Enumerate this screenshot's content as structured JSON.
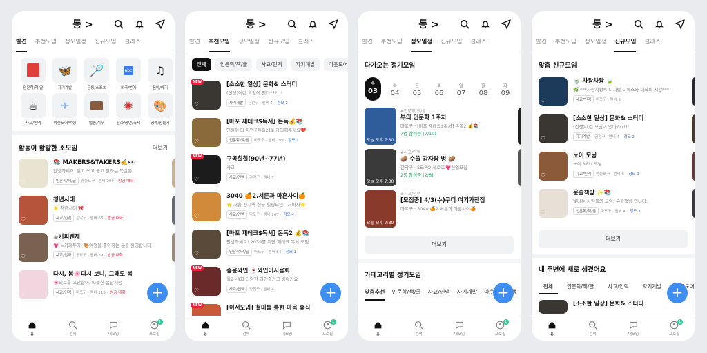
{
  "common": {
    "location": "동 >",
    "tabs": [
      "발견",
      "추천모임",
      "정모일정",
      "신규모임",
      "클래스"
    ],
    "nav": [
      "홈",
      "검색",
      "내모임",
      "프로필"
    ],
    "nav_badge": "1",
    "fab": "+",
    "new_badge": "NEW"
  },
  "discover": {
    "categories": [
      {
        "label": "인문학/책/글",
        "icon": "book-icon",
        "color": "#e0403c"
      },
      {
        "label": "자기계발",
        "icon": "butterfly-icon",
        "color": "#3f7be8"
      },
      {
        "label": "운동/스포츠",
        "icon": "racket-icon",
        "color": "#c98b2c"
      },
      {
        "label": "외국/언어",
        "icon": "abc-icon",
        "color": "#3f7be8"
      },
      {
        "label": "음악/악기",
        "icon": "music-note-icon",
        "color": "#222222"
      },
      {
        "label": "사교/인맥",
        "icon": "coffee-icon",
        "color": "#333333"
      },
      {
        "label": "아웃도어/여행",
        "icon": "airplane-icon",
        "color": "#8fb6e8"
      },
      {
        "label": "업종/직무",
        "icon": "briefcase-icon",
        "color": "#8a5a3c"
      },
      {
        "label": "문화/공연/축제",
        "icon": "firework-icon",
        "color": "#d13a3a"
      },
      {
        "label": "공예/만들기",
        "icon": "palette-icon",
        "color": "#d69a3a"
      }
    ],
    "section_title": "활동이 활발한 소모임",
    "more": "더보기",
    "items": [
      {
        "title": "📚 MAKERS&TAKERS✍️👀",
        "desc": "안녕하세요. 읽고 쓰고 듣고 말하는 북살롱",
        "tag": "인문학/책/글",
        "meta": "영등포구 · 멤버 290 ·",
        "status": "방금 대화",
        "thumb": "#e9e3d2"
      },
      {
        "title": "청년시대",
        "desc": "⭐ 청년시대 🎀",
        "tag": "사교/인맥",
        "meta": "관악구 · 멤버 68 ·",
        "status": "방금 대화",
        "thumb": "#b5543a"
      },
      {
        "title": "☕커피렌체",
        "desc": "💗 ☕카페투어, 🎨여행을 좋아하는 분들 환영합니다",
        "tag": "사교/인맥",
        "meta": "동작구 · 멤버 39 ·",
        "status": "방금 대화",
        "thumb": "#7a6252"
      },
      {
        "title": "다시, 봄🌸다시 보니, 그래도 봄",
        "desc": "🌸외로움 고단함이, 따뜻한 봄날처럼",
        "tag": "사교/인맥",
        "meta": "마포구 · 멤버 113 ·",
        "status": "방금 대화",
        "thumb": "#f2d6df"
      }
    ]
  },
  "recommend": {
    "chips": [
      "전체",
      "인문학/책/글",
      "사교/인맥",
      "자기계발",
      "아웃도어/여행"
    ],
    "items": [
      {
        "title": "[소소한 일상] 문화& 스터디",
        "desc": "(신생)이런 모임이 있다???!!!",
        "tag": "자기계발",
        "meta": "금천구 · 멤버 4 ·",
        "status": "정모 2",
        "thumb": "#3a3632",
        "new": true
      },
      {
        "title": "[마포 재테크$독서] 돈독💰📚",
        "desc": "인원이 다 차면 [돈독2]로 가입해주세요❤️",
        "tag": "인문학/책/글",
        "meta": "마포구 · 멤버 299 ·",
        "status": "정모 1",
        "thumb": "#8a6a3a",
        "new": false
      },
      {
        "title": "구공칠칠(90년~77년)",
        "desc": "사교",
        "tag": "사교/인맥",
        "meta": "관악구 · 멤버 7",
        "status": "",
        "thumb": "#1c1c1c",
        "new": true
      },
      {
        "title": "3040 🍊2.서른과 마흔사이🍊",
        "desc": "⭐ 서울 전지역 싱글 힐링모임 - 서마사⭐",
        "tag": "사교/인맥",
        "meta": "마포구 · 멤버 267 ·",
        "status": "정모 4",
        "thumb": "#d08a3a",
        "new": false
      },
      {
        "title": "[마포 재테크$독서] 돈독2 💰📚",
        "desc": "안녕하세요! 2039를 위한 재테크 독서 모임.",
        "tag": "인문학/책/글",
        "meta": "마포구 · 멤버 64 ·",
        "status": "정모 1",
        "thumb": "#5a4a3a",
        "new": false
      },
      {
        "title": "송윤와인 🍷와인이시음회",
        "desc": "월2~4회 다양한 와인즐기고 배워가요",
        "tag": "사교/인맥",
        "meta": "양천구 · 멤버 4",
        "status": "",
        "thumb": "#6a2a2a",
        "new": true
      },
      {
        "title": "[이서모임] 철미를 통한 마음 휴식",
        "desc": "",
        "tag": "",
        "meta": "",
        "status": "",
        "thumb": "#c85a3a",
        "new": true
      }
    ]
  },
  "schedule": {
    "section_title": "다가오는 정기모임",
    "dates": [
      {
        "day": "수",
        "num": "03"
      },
      {
        "day": "목",
        "num": "04"
      },
      {
        "day": "금",
        "num": "05"
      },
      {
        "day": "토",
        "num": "06"
      },
      {
        "day": "일",
        "num": "07"
      },
      {
        "day": "월",
        "num": "08"
      },
      {
        "day": "화",
        "num": "09"
      }
    ],
    "items": [
      {
        "cat": "#인문학/책/글",
        "title": "부의 인문학 1주차",
        "place": "마포구 · [마포 재테크$독서] 돈독2 💰📚",
        "attend": "7명 참석중 (7/10)",
        "time": "오늘 오후 7:30",
        "thumb": "#2f5c9a"
      },
      {
        "cat": "#사교/인맥",
        "title": "🥔 수쓸 감자탕 벙 🥔",
        "place": "관악구 · SE:RO 세로🐭💗신입모집",
        "attend": "2명 참석중 (2/8)",
        "time": "오늘 오후 7:30",
        "thumb": "#3a3a3a"
      },
      {
        "cat": "#사교/인맥",
        "title": "[모집중] 4/3(수)구디 여기가전집",
        "place": "마포구 · 3040 🍊2.서른과 마흔사이🍊",
        "attend": "",
        "time": "오늘 오후 7:30",
        "thumb": "#8a3a2a"
      }
    ],
    "more": "더보기",
    "cat_title": "카테고리별 정기모임",
    "cat_tabs": [
      "맞춤추천",
      "인문학/책/글",
      "사교/인맥",
      "자기계발",
      "아웃도어/여행"
    ]
  },
  "newgroups": {
    "section_title": "맞춤 신규모임",
    "items": [
      {
        "title": "🍵 차왕차왕 🍃",
        "desc": "🌿 ***차왕차왕*: 디지털 디톡스와 대화의 시간***",
        "tag": "사교/인맥",
        "meta": "마포구 · 멤버 5",
        "status": "",
        "thumb": "#1c3a5a"
      },
      {
        "title": "[소소한 일상] 문화& 스터디",
        "desc": "(신생)이런 모임이 있다???!!!",
        "tag": "자기계발",
        "meta": "금천구 · 멤버 4 ·",
        "status": "정모 2",
        "thumb": "#3a3632"
      },
      {
        "title": "노이 모닝",
        "desc": "노이 NEU 모닝",
        "tag": "사교/인맥",
        "meta": "영등포구 · 멤버 6 ·",
        "status": "정모 1",
        "thumb": "#8a5a3a"
      },
      {
        "title": "윤슬책방 ✨📚",
        "desc": "빛나는 사람들의 모임, 윤슬책방 입니다.",
        "tag": "인문학/책/글",
        "meta": "마포구 · 멤버 4 ·",
        "status": "정모 3",
        "thumb": "#e6e0d6"
      }
    ],
    "more": "더보기",
    "nearby_title": "내 주변에 새로 생겼어요",
    "chips": [
      "전체",
      "인문학/책/글",
      "사교/인맥",
      "자기계발",
      "아웃도어/여행"
    ],
    "peek_title": "[소소한 일상] 문화& 스터디"
  }
}
